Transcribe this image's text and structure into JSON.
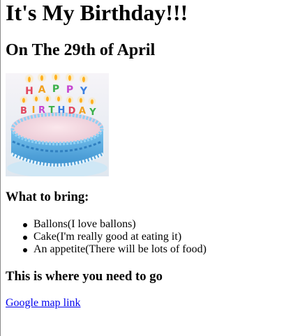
{
  "heading": "It's My Birthday!!!",
  "date_line": "On The 29th of April",
  "image": {
    "alt": "Happy Birthday cake",
    "cake_text_row1": "HAPPY",
    "cake_text_row2": "BIRTHDAY",
    "colors": {
      "frosting": "#5fb4e6",
      "frosting_dark": "#2f7fc0",
      "top": "#f4d6e0",
      "plate": "#c9e6f7"
    }
  },
  "bring_heading": "What to bring:",
  "bring_items": [
    "Ballons(I love ballons)",
    "Cake(I'm really good at eating it)",
    "An appetite(There will be lots of food)"
  ],
  "go_heading": "This is where you need to go",
  "map_link_text": "Google map link",
  "link_color": "#0000ee"
}
